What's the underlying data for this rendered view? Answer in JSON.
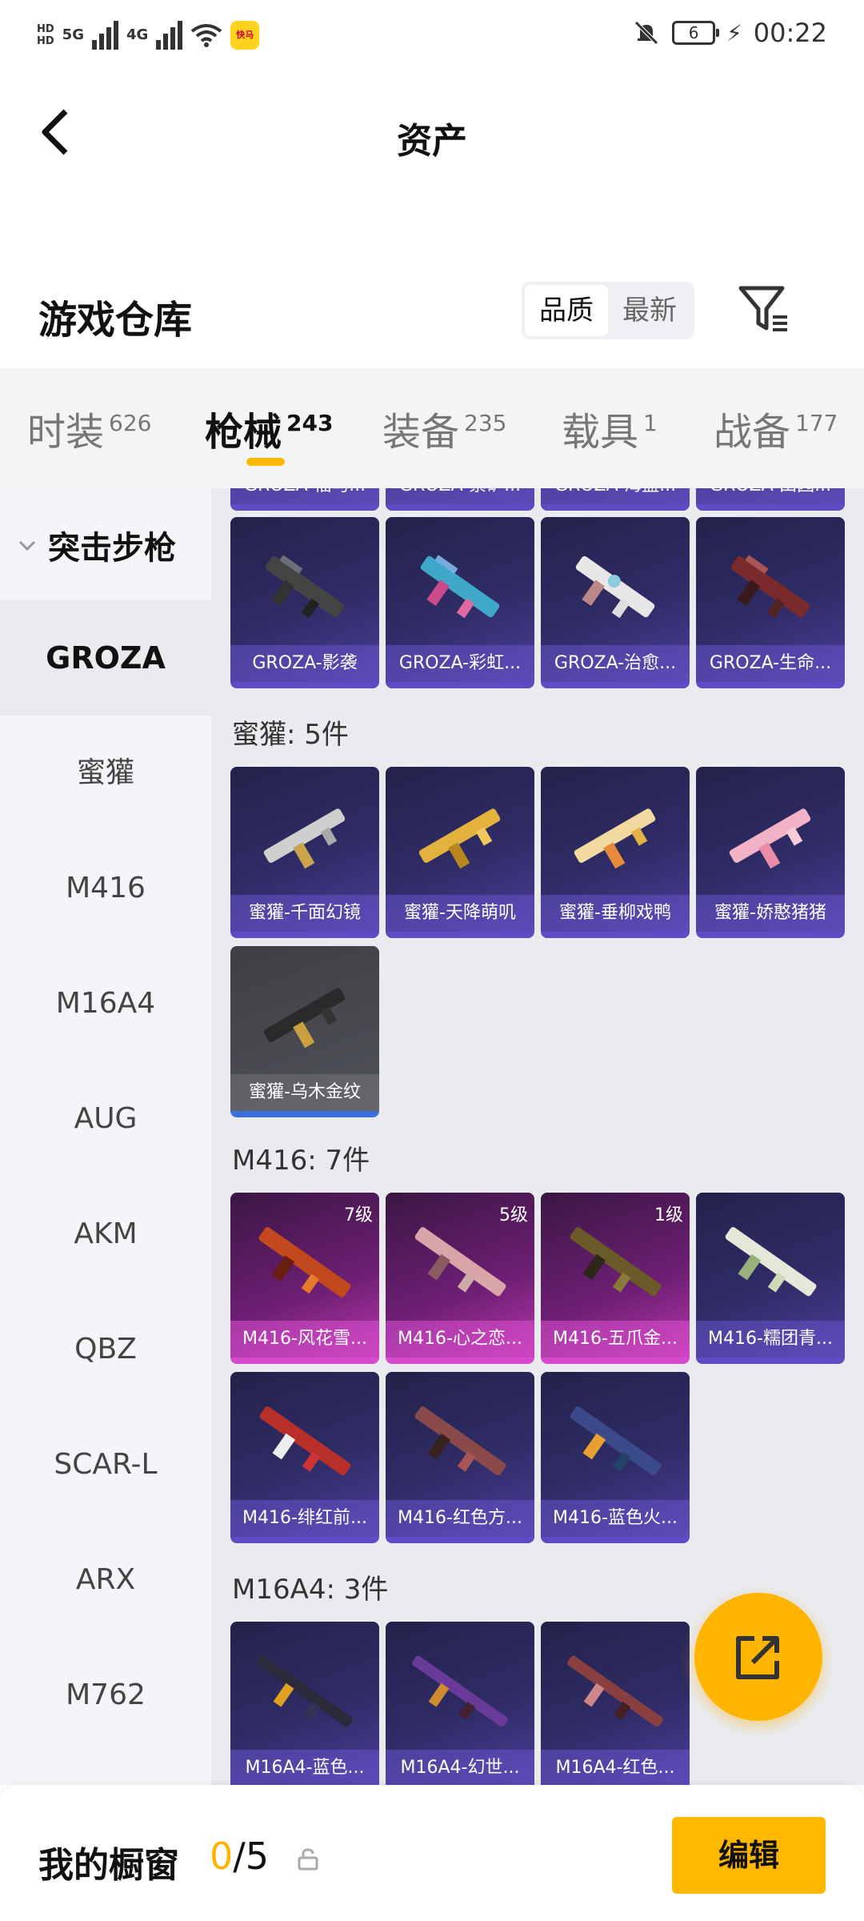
{
  "status_bar": {
    "hd1": "HD",
    "hd2": "HD",
    "net1": "5G",
    "net2": "4G",
    "app_badge": "快马",
    "battery": "6",
    "time": "00:22"
  },
  "header": {
    "title": "资产"
  },
  "warehouse": {
    "title": "游戏仓库",
    "sort_options": [
      "品质",
      "最新"
    ]
  },
  "tabs": [
    {
      "label": "时装",
      "count": "626"
    },
    {
      "label": "枪械",
      "count": "243"
    },
    {
      "label": "装备",
      "count": "235"
    },
    {
      "label": "载具",
      "count": "1"
    },
    {
      "label": "战备",
      "count": "177"
    }
  ],
  "sidebar": {
    "group": "突击步枪",
    "items": [
      "GROZA",
      "蜜獾",
      "M416",
      "M16A4",
      "AUG",
      "AKM",
      "QBZ",
      "SCAR-L",
      "ARX",
      "M762"
    ]
  },
  "grid": {
    "top_partial": [
      "GROZA-福马...",
      "GROZA-紫矿...",
      "GROZA-海盗...",
      "GROZA-田园..."
    ],
    "groza_row": [
      "GROZA-影袭",
      "GROZA-彩虹...",
      "GROZA-治愈...",
      "GROZA-生命..."
    ],
    "honey_header": "蜜獾: 5件",
    "honey": [
      "蜜獾-千面幻镜",
      "蜜獾-天降萌叽",
      "蜜獾-垂柳戏鸭",
      "蜜獾-娇憨猪猪",
      "蜜獾-乌木金纹"
    ],
    "m416_header": "M416: 7件",
    "m416": [
      "M416-风花雪...",
      "M416-心之恋...",
      "M416-五爪金...",
      "M416-糯团青...",
      "M416-绯红前...",
      "M416-红色方...",
      "M416-蓝色火..."
    ],
    "m416_levels": [
      "7级",
      "5级",
      "1级"
    ],
    "m16_header": "M16A4: 3件",
    "m16": [
      "M16A4-蓝色...",
      "M16A4-幻世...",
      "M16A4-红色..."
    ]
  },
  "bottom": {
    "title": "我的橱窗",
    "current": "0",
    "max": "/5",
    "edit": "编辑"
  },
  "colors": {
    "accent": "#ffb800",
    "card_purple": "#2f2c66",
    "card_legend": "#b838ac"
  }
}
